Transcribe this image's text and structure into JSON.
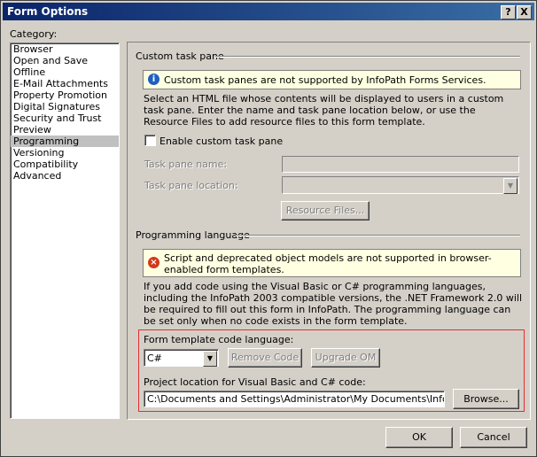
{
  "window": {
    "title": "Form Options",
    "help_label": "?",
    "close_label": "X"
  },
  "category": {
    "label": "Category:",
    "items": [
      "Browser",
      "Open and Save",
      "Offline",
      "E-Mail Attachments",
      "Property Promotion",
      "Digital Signatures",
      "Security and Trust",
      "Preview",
      "Programming",
      "Versioning",
      "Compatibility",
      "Advanced"
    ],
    "selected": "Programming"
  },
  "custom_task_pane": {
    "heading": "Custom task pane",
    "info_message": "Custom task panes are not supported by InfoPath Forms Services.",
    "description": "Select an HTML file whose contents will be displayed to users in a custom task pane. Enter the name and task pane location below, or use the Resource Files to add resource files to this form template.",
    "enable_checkbox_label": "Enable custom task pane",
    "enable_checked": false,
    "name_label": "Task pane name:",
    "location_label": "Task pane location:",
    "resource_files_button": "Resource Files..."
  },
  "programming_language": {
    "heading": "Programming language",
    "warning_message": "Script and deprecated object models are not supported in browser-enabled form templates.",
    "description": "If you add code using the Visual Basic or C# programming languages, including the InfoPath 2003 compatible versions, the .NET Framework 2.0 will be required to fill out this form in InfoPath. The programming language can be set only when no code exists in the form template.",
    "code_language_label": "Form template code language:",
    "code_language_value": "C#",
    "remove_code_button": "Remove Code",
    "upgrade_om_button": "Upgrade OM",
    "project_location_label": "Project location for Visual Basic and C# code:",
    "project_location_value": "C:\\Documents and Settings\\Administrator\\My Documents\\InfoPath Pro",
    "browse_button": "Browse..."
  },
  "footer": {
    "ok_button": "OK",
    "cancel_button": "Cancel"
  },
  "colors": {
    "titlebar": "#0a246a",
    "dialog_bg": "#d4d0c8",
    "highlight_border": "#e03030",
    "info_bg": "#ffffe1"
  }
}
